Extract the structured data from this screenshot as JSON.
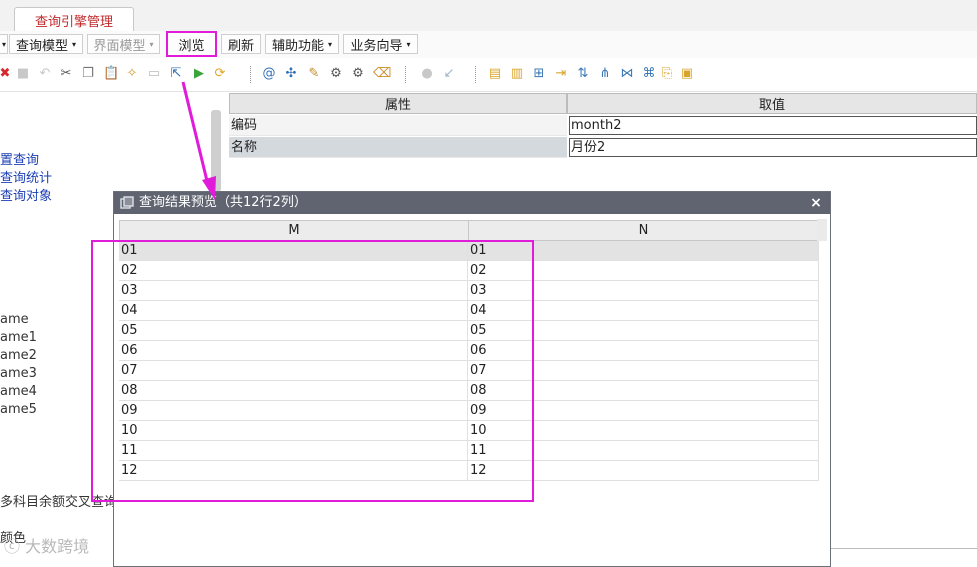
{
  "tabs": [
    {
      "label": "查询引擎管理",
      "active": true
    }
  ],
  "menubar": {
    "items": [
      {
        "label": "查询模型",
        "dropdown": true,
        "enabled": true
      },
      {
        "label": "界面模型",
        "dropdown": true,
        "enabled": false
      },
      {
        "label": "浏览",
        "dropdown": false,
        "enabled": true,
        "highlighted": true
      },
      {
        "label": "刷新",
        "dropdown": false,
        "enabled": true
      },
      {
        "label": "辅助功能",
        "dropdown": true,
        "enabled": true
      },
      {
        "label": "业务向导",
        "dropdown": true,
        "enabled": true
      }
    ]
  },
  "toolbar": {
    "icons": [
      "delete-icon",
      "stop-icon",
      "undo-icon",
      "cut-icon",
      "copy-icon",
      "paste-icon",
      "wizard-icon",
      "layout-icon",
      "export-icon",
      "run-icon",
      "refresh-icon",
      "at-icon",
      "magic-icon",
      "pencil-icon",
      "gear-icon",
      "gears-icon",
      "eraser-icon",
      "disabled-circle-icon",
      "arrow-down-left-icon",
      "db-icon",
      "db-search-icon",
      "tree-icon",
      "import-icon",
      "sort-icon",
      "split-icon",
      "join-icon",
      "cross-icon",
      "paste-in-icon",
      "clipboard-icon"
    ]
  },
  "left_tree": {
    "links": [
      "置查询",
      "查询统计",
      "查询对象"
    ],
    "names": [
      "ame",
      "ame1",
      "ame2",
      "ame3",
      "ame4",
      "ame5"
    ],
    "bottom_items": [
      "多科目余额交叉查询",
      "颜色"
    ]
  },
  "property_grid": {
    "headers": [
      "属性",
      "取值"
    ],
    "rows": [
      {
        "label": "编码",
        "value": "month2"
      },
      {
        "label": "名称",
        "value": "月份2"
      }
    ]
  },
  "dialog": {
    "title": "查询结果预览（共12行2列）",
    "close_label": "×",
    "columns": [
      "M",
      "N"
    ],
    "rows": [
      [
        "01",
        "01"
      ],
      [
        "02",
        "02"
      ],
      [
        "03",
        "03"
      ],
      [
        "04",
        "04"
      ],
      [
        "05",
        "05"
      ],
      [
        "06",
        "06"
      ],
      [
        "07",
        "07"
      ],
      [
        "08",
        "08"
      ],
      [
        "09",
        "09"
      ],
      [
        "10",
        "10"
      ],
      [
        "11",
        "11"
      ],
      [
        "12",
        "12"
      ]
    ],
    "selected_row": 0
  },
  "watermark": "大数跨境",
  "colors": {
    "accent": "#e01bd9",
    "tab_text": "#c0292b",
    "link": "#1c3fb5",
    "dialog_title_bg": "#5f6470"
  }
}
